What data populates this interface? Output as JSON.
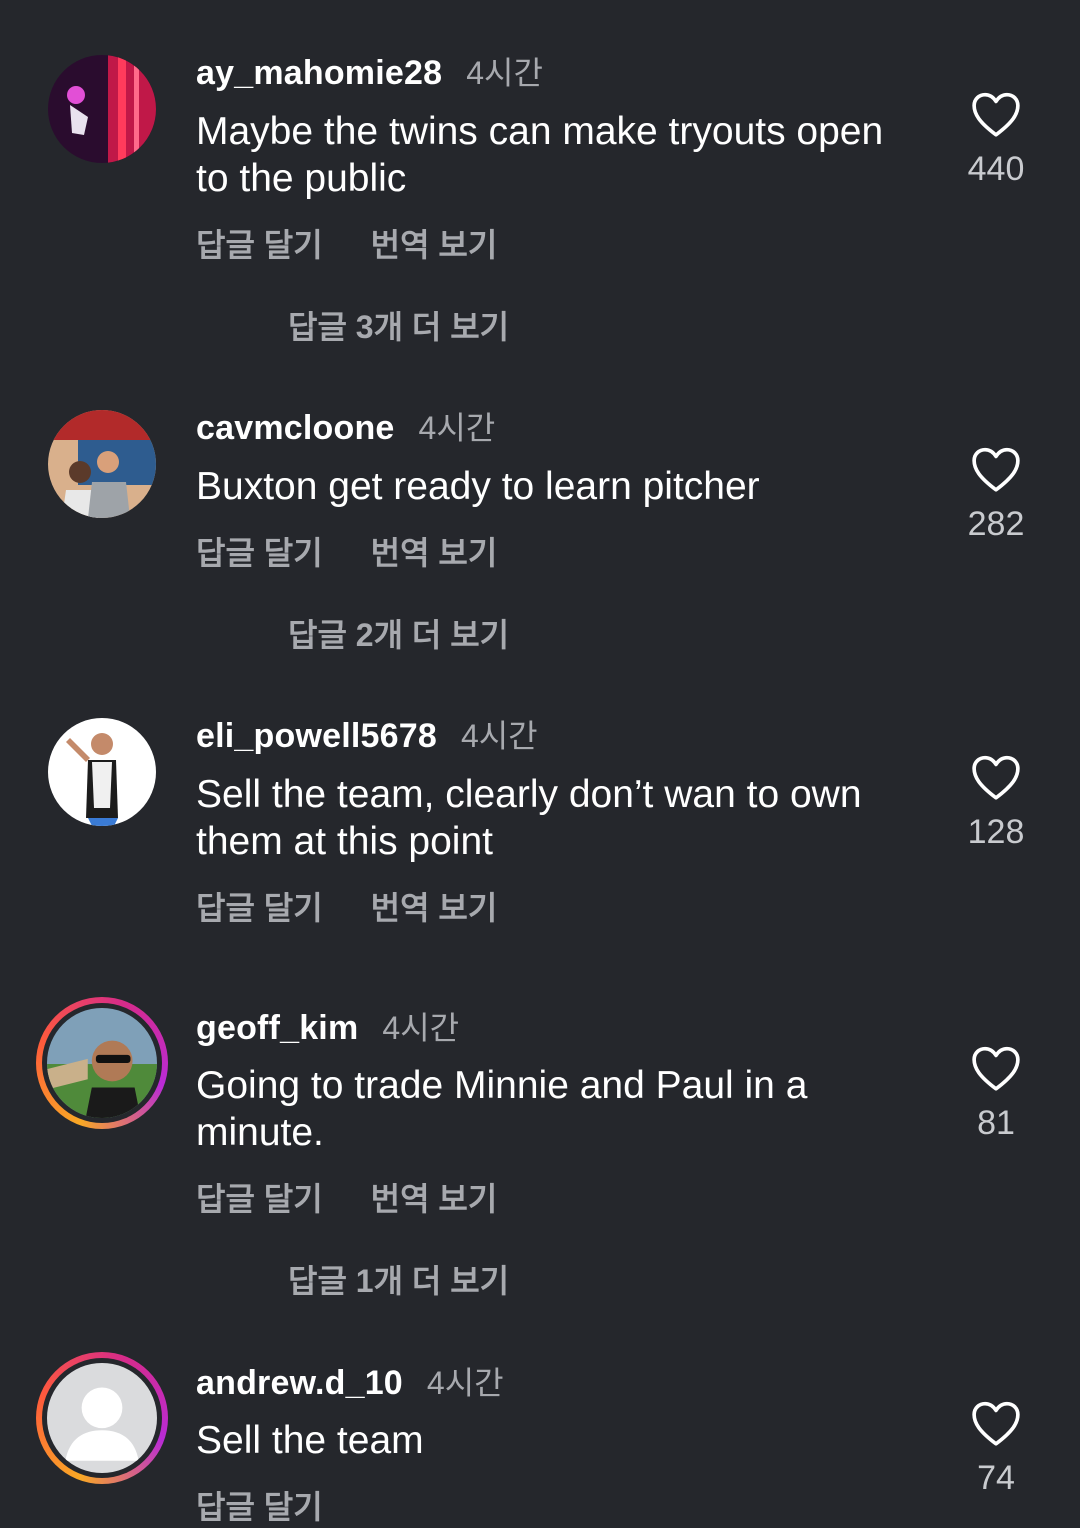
{
  "comments": [
    {
      "username": "ay_mahomie28",
      "time": "4시간",
      "text": "Maybe the twins can make tryouts open to the public",
      "reply_label": "답글 달기",
      "translate_label": "번역 보기",
      "likes": "440",
      "more_replies": "답글 3개 더 보기"
    },
    {
      "username": "cavmcloone",
      "time": "4시간",
      "text": "Buxton get ready to learn pitcher",
      "reply_label": "답글 달기",
      "translate_label": "번역 보기",
      "likes": "282",
      "more_replies": "답글 2개 더 보기"
    },
    {
      "username": "eli_powell5678",
      "time": "4시간",
      "text": "Sell the team, clearly don’t wan to own them at this point",
      "reply_label": "답글 달기",
      "translate_label": "번역 보기",
      "likes": "128"
    },
    {
      "username": "geoff_kim",
      "time": "4시간",
      "text": "Going to trade Minnie and Paul in a minute.",
      "reply_label": "답글 달기",
      "translate_label": "번역 보기",
      "likes": "81",
      "more_replies": "답글 1개 더 보기"
    },
    {
      "username": "andrew.d_10",
      "time": "4시간",
      "text": "Sell the team",
      "reply_label": "답글 달기",
      "likes": "74"
    }
  ],
  "icons": {
    "like": "heart-outline-icon"
  },
  "colors": {
    "background": "#25272c",
    "secondary_text": "#a7a9ae"
  }
}
